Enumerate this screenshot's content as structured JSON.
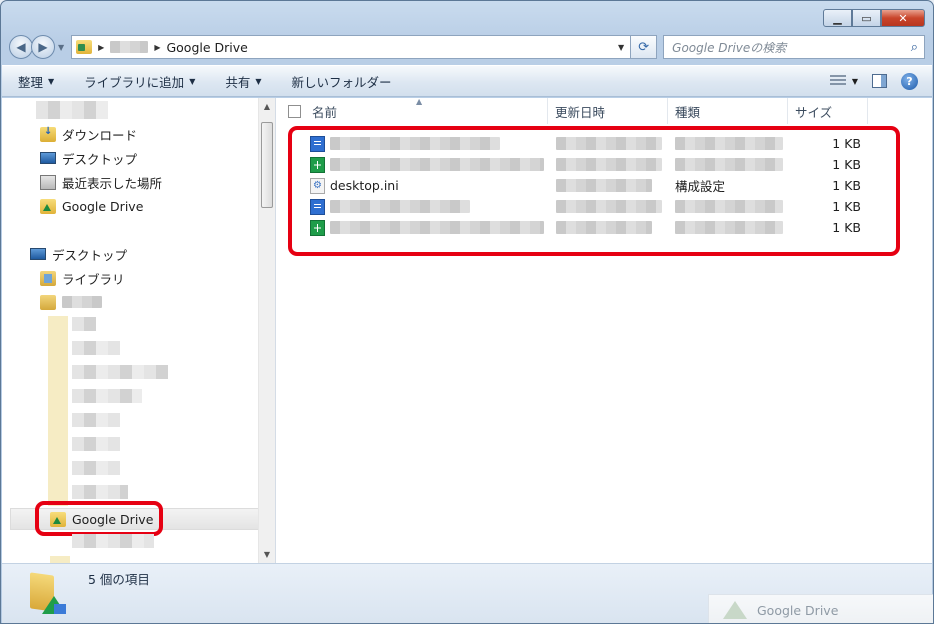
{
  "window": {
    "address_current": "Google Drive",
    "search_placeholder": "Google Driveの検索"
  },
  "toolbar": {
    "organize": "整理",
    "add_to_library": "ライブラリに追加",
    "share": "共有",
    "new_folder": "新しいフォルダー"
  },
  "nav": {
    "downloads": "ダウンロード",
    "desktop": "デスクトップ",
    "recent": "最近表示した場所",
    "google_drive": "Google Drive",
    "desktop_root": "デスクトップ",
    "libraries": "ライブラリ",
    "google_drive_tree": "Google Drive"
  },
  "columns": {
    "name": "名前",
    "modified": "更新日時",
    "type": "種類",
    "size": "サイズ"
  },
  "files": [
    {
      "icon": "doc-icon",
      "name": "",
      "type": "",
      "size": "1 KB"
    },
    {
      "icon": "sheet-icon",
      "name": "",
      "type": "",
      "size": "1 KB"
    },
    {
      "icon": "ini-icon",
      "name": "desktop.ini",
      "type": "構成設定",
      "size": "1 KB"
    },
    {
      "icon": "doc-icon",
      "name": "",
      "type": "",
      "size": "1 KB"
    },
    {
      "icon": "sheet-icon",
      "name": "",
      "type": "",
      "size": "1 KB"
    }
  ],
  "status": {
    "count": "5 個の項目"
  },
  "toast": {
    "label": "Google Drive"
  },
  "colors": {
    "highlight": "#e60012",
    "doc": "#2f6fd1",
    "sheet": "#1f9d4a"
  }
}
